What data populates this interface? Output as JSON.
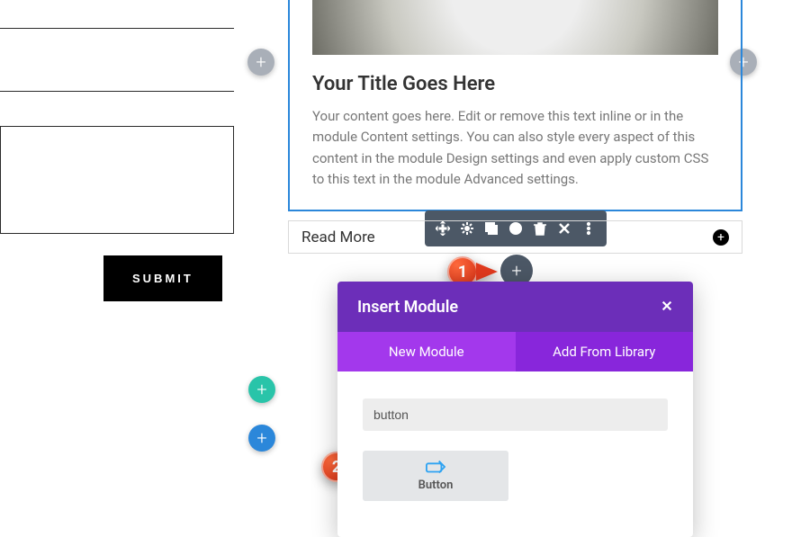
{
  "left_form": {
    "submit_label": "SUBMIT"
  },
  "blurb": {
    "title": "Your Title Goes Here",
    "body": "Your content goes here. Edit or remove this text inline or in the module Content settings. You can also style every aspect of this content in the module Design settings and even apply custom CSS to this text in the module Advanced settings."
  },
  "read_more": {
    "label": "Read More"
  },
  "markers": {
    "one": "1",
    "two": "2"
  },
  "modal": {
    "title": "Insert Module",
    "tab_new": "New Module",
    "tab_library": "Add From Library",
    "search_value": "button",
    "module_button_label": "Button"
  }
}
